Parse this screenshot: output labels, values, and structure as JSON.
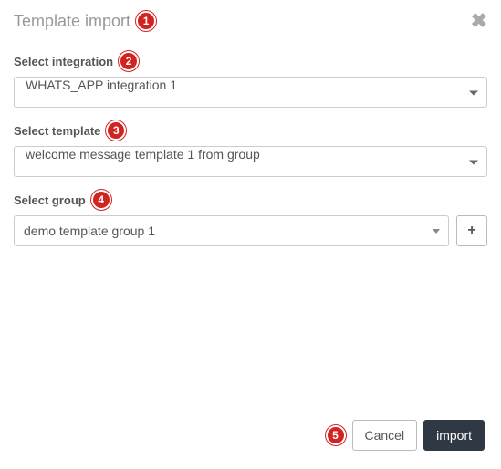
{
  "modal": {
    "title": "Template import",
    "badge": "1"
  },
  "fields": {
    "integration": {
      "label": "Select integration",
      "badge": "2",
      "value": "WHATS_APP integration 1"
    },
    "template": {
      "label": "Select template",
      "badge": "3",
      "value": "welcome message template 1 from group"
    },
    "group": {
      "label": "Select group",
      "badge": "4",
      "value": "demo template group 1"
    }
  },
  "footer": {
    "badge": "5",
    "cancel": "Cancel",
    "import": "import"
  },
  "icons": {
    "close": "✖",
    "plus": "+"
  }
}
